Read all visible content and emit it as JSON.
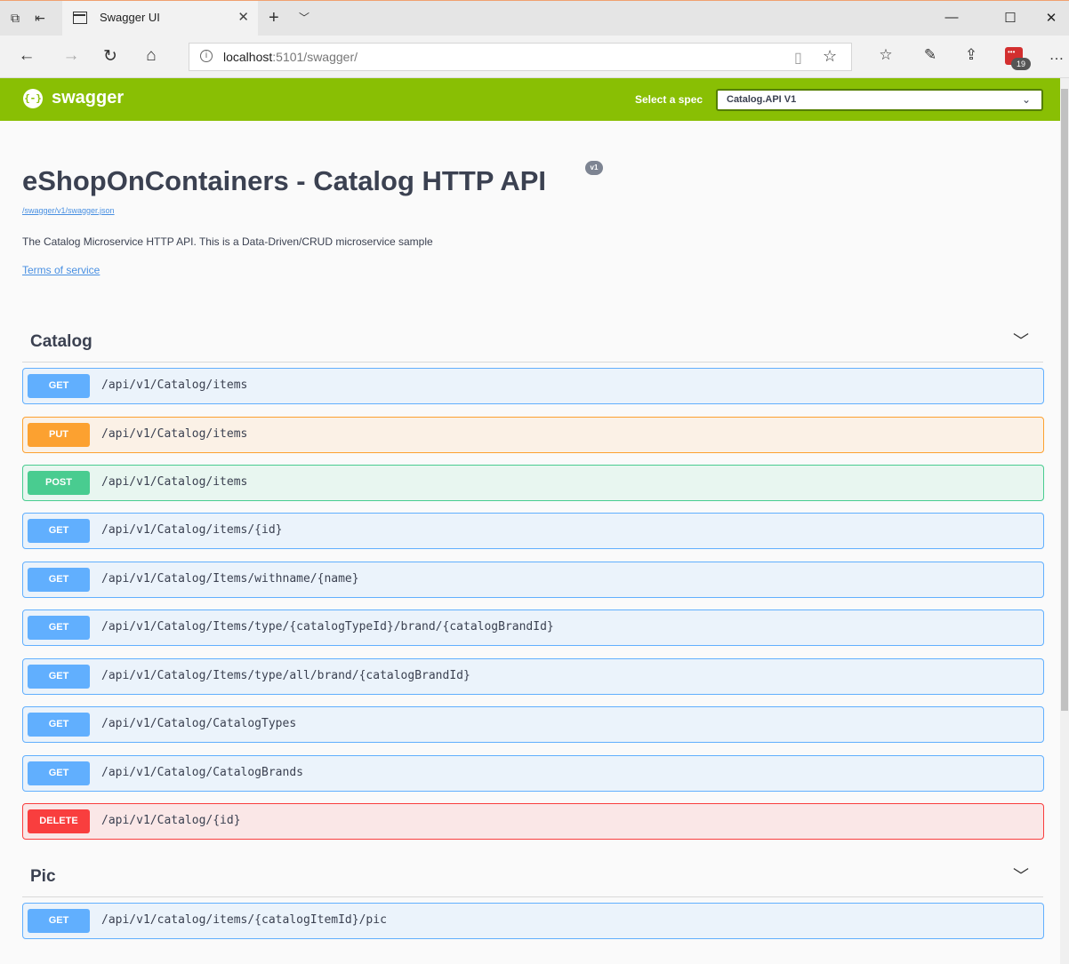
{
  "browser": {
    "tab_title": "Swagger UI",
    "url_host": "localhost",
    "url_rest": ":5101/swagger/",
    "extension_badge": "19"
  },
  "topbar": {
    "logo_text": "swagger",
    "select_label": "Select a spec",
    "selected_spec": "Catalog.API V1"
  },
  "info": {
    "title": "eShopOnContainers - Catalog HTTP API",
    "version": "v1",
    "spec_url": "/swagger/v1/swagger.json",
    "description": "The Catalog Microservice HTTP API. This is a Data-Driven/CRUD microservice sample",
    "terms_link": "Terms of service"
  },
  "sections": [
    {
      "name": "Catalog",
      "operations": [
        {
          "method": "GET",
          "path": "/api/v1/Catalog/items"
        },
        {
          "method": "PUT",
          "path": "/api/v1/Catalog/items"
        },
        {
          "method": "POST",
          "path": "/api/v1/Catalog/items"
        },
        {
          "method": "GET",
          "path": "/api/v1/Catalog/items/{id}"
        },
        {
          "method": "GET",
          "path": "/api/v1/Catalog/Items/withname/{name}"
        },
        {
          "method": "GET",
          "path": "/api/v1/Catalog/Items/type/{catalogTypeId}/brand/{catalogBrandId}"
        },
        {
          "method": "GET",
          "path": "/api/v1/Catalog/Items/type/all/brand/{catalogBrandId}"
        },
        {
          "method": "GET",
          "path": "/api/v1/Catalog/CatalogTypes"
        },
        {
          "method": "GET",
          "path": "/api/v1/Catalog/CatalogBrands"
        },
        {
          "method": "DELETE",
          "path": "/api/v1/Catalog/{id}"
        }
      ]
    },
    {
      "name": "Pic",
      "operations": [
        {
          "method": "GET",
          "path": "/api/v1/catalog/items/{catalogItemId}/pic"
        }
      ]
    }
  ],
  "colors": {
    "topbar": "#89bf04",
    "get": "#61affe",
    "put": "#fca130",
    "post": "#49cc90",
    "delete": "#f93e3e"
  }
}
